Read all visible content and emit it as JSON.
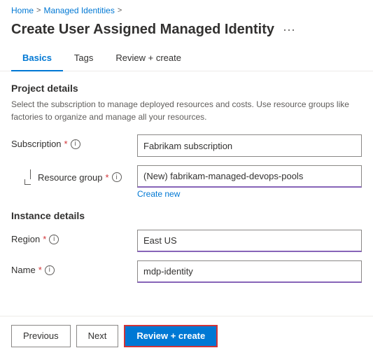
{
  "breadcrumb": {
    "home": "Home",
    "managed_identities": "Managed Identities",
    "sep1": ">",
    "sep2": ">"
  },
  "page": {
    "title": "Create User Assigned Managed Identity",
    "ellipsis": "···"
  },
  "tabs": [
    {
      "id": "basics",
      "label": "Basics",
      "active": true
    },
    {
      "id": "tags",
      "label": "Tags",
      "active": false
    },
    {
      "id": "review-create",
      "label": "Review + create",
      "active": false
    }
  ],
  "project_details": {
    "section_title": "Project details",
    "description": "Select the subscription to manage deployed resources and costs. Use resource groups like factories to organize and manage all your resources.",
    "subscription": {
      "label": "Subscription",
      "required": "*",
      "info": "i",
      "value": "Fabrikam subscription"
    },
    "resource_group": {
      "label": "Resource group",
      "required": "*",
      "info": "i",
      "value": "(New) fabrikam-managed-devops-pools",
      "create_new": "Create new"
    }
  },
  "instance_details": {
    "section_title": "Instance details",
    "region": {
      "label": "Region",
      "required": "*",
      "info": "i",
      "value": "East US"
    },
    "name": {
      "label": "Name",
      "required": "*",
      "info": "i",
      "value": "mdp-identity"
    }
  },
  "footer": {
    "previous_label": "Previous",
    "next_label": "Next",
    "review_create_label": "Review + create"
  }
}
